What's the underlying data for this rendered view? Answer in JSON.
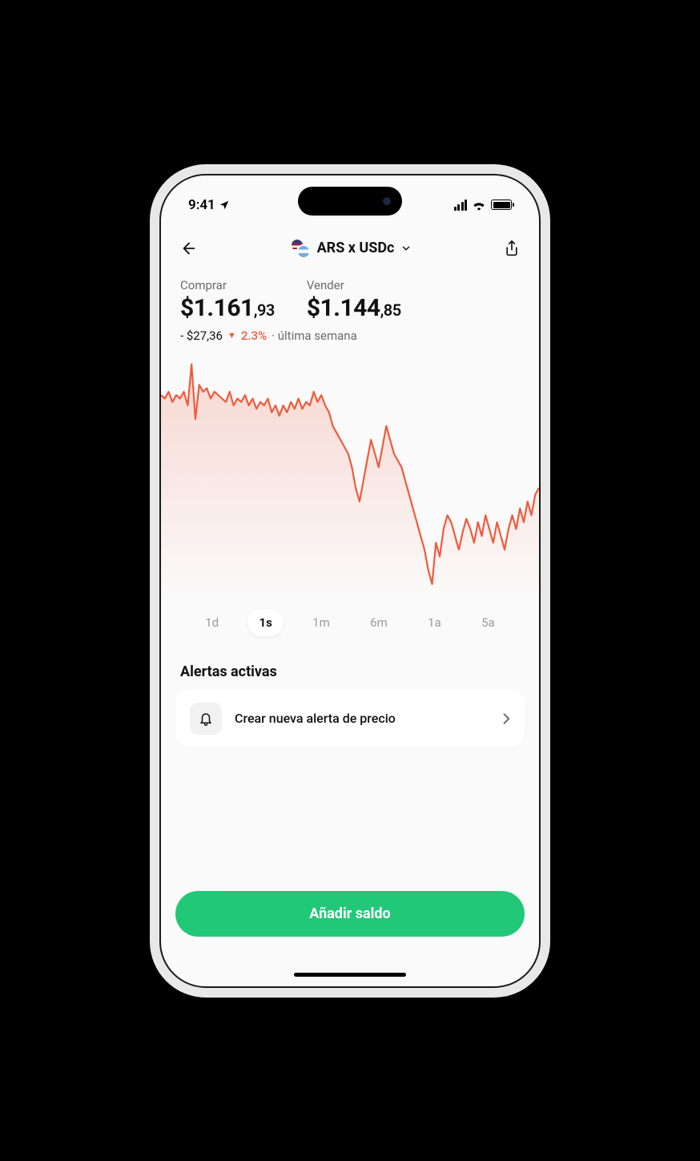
{
  "status": {
    "time": "9:41"
  },
  "header": {
    "pair": "ARS x USDc"
  },
  "prices": {
    "buy_label": "Comprar",
    "buy_value": "$1.161",
    "buy_dec": ",93",
    "sell_label": "Vender",
    "sell_value": "$1.144",
    "sell_dec": ",85"
  },
  "delta": {
    "amount": "- $27,36",
    "pct": "2.3%",
    "period_prefix": "· ",
    "period": "última semana"
  },
  "ranges": [
    "1d",
    "1s",
    "1m",
    "6m",
    "1a",
    "5a"
  ],
  "ranges_active_index": 1,
  "alerts": {
    "title": "Alertas activas",
    "create_label": "Crear nueva alerta de precio"
  },
  "cta": {
    "label": "Añadir saldo"
  },
  "colors": {
    "accent": "#21c878",
    "chart": "#f05a3c"
  },
  "chart_data": {
    "type": "line",
    "title": "",
    "xlabel": "",
    "ylabel": "",
    "ylim": [
      1130,
      1200
    ],
    "x": [
      0,
      1,
      2,
      3,
      4,
      5,
      6,
      7,
      8,
      9,
      10,
      11,
      12,
      13,
      14,
      15,
      16,
      17,
      18,
      19,
      20,
      21,
      22,
      23,
      24,
      25,
      26,
      27,
      28,
      29,
      30,
      31,
      32,
      33,
      34,
      35,
      36,
      37,
      38,
      39,
      40,
      41,
      42,
      43,
      44,
      45,
      46,
      47,
      48,
      49,
      50,
      51,
      52,
      53,
      54,
      55,
      56,
      57,
      58,
      59,
      60,
      61,
      62,
      63,
      64,
      65,
      66,
      67,
      68,
      69,
      70,
      71,
      72,
      73,
      74,
      75,
      76,
      77,
      78,
      79,
      80,
      81,
      82,
      83,
      84,
      85,
      86,
      87,
      88,
      89,
      90,
      91,
      92,
      93,
      94,
      95,
      96,
      97,
      98,
      99
    ],
    "values": [
      1189,
      1188,
      1190,
      1187,
      1189,
      1188,
      1190,
      1186,
      1198,
      1182,
      1192,
      1190,
      1191,
      1188,
      1190,
      1189,
      1188,
      1187,
      1190,
      1186,
      1188,
      1187,
      1189,
      1186,
      1188,
      1185,
      1187,
      1186,
      1188,
      1184,
      1186,
      1183,
      1186,
      1184,
      1187,
      1185,
      1188,
      1185,
      1187,
      1186,
      1190,
      1187,
      1189,
      1186,
      1184,
      1180,
      1178,
      1176,
      1174,
      1172,
      1168,
      1162,
      1158,
      1164,
      1170,
      1176,
      1172,
      1168,
      1174,
      1180,
      1176,
      1172,
      1170,
      1168,
      1164,
      1160,
      1156,
      1152,
      1148,
      1144,
      1138,
      1134,
      1146,
      1142,
      1150,
      1154,
      1152,
      1148,
      1144,
      1149,
      1153,
      1150,
      1146,
      1152,
      1148,
      1154,
      1150,
      1146,
      1152,
      1148,
      1144,
      1150,
      1154,
      1150,
      1156,
      1152,
      1158,
      1154,
      1160,
      1162
    ]
  }
}
